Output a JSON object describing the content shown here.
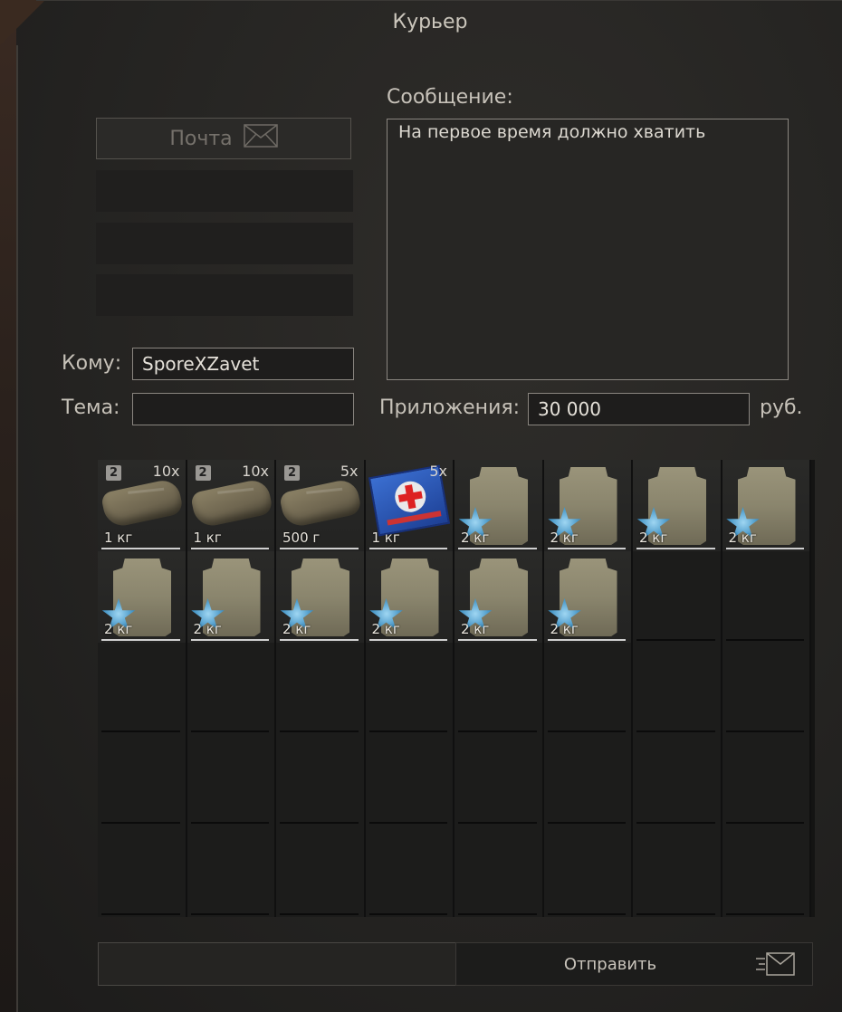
{
  "window": {
    "title": "Курьер"
  },
  "left_panel": {
    "mail_button": {
      "label": "Почта",
      "icon": "envelope-icon"
    },
    "empty_slots": 3
  },
  "form": {
    "to_label": "Кому:",
    "to_value": "SporeXZavet",
    "subject_label": "Тема:",
    "subject_value": "",
    "message_label": "Сообщение:",
    "message_text": "На первое время должно хватить",
    "attachments_label": "Приложения:",
    "attachments_value": "30 000",
    "currency": "руб."
  },
  "inventory": {
    "columns": 8,
    "rows": 5,
    "items": [
      {
        "kind": "bandage",
        "level": "2",
        "count": "10x",
        "weight": "1 кг"
      },
      {
        "kind": "bandage",
        "level": "2",
        "count": "10x",
        "weight": "1 кг"
      },
      {
        "kind": "bandage",
        "level": "2",
        "count": "5x",
        "weight": "500 г"
      },
      {
        "kind": "medkit",
        "level": "",
        "count": "5x",
        "weight": "1 кг"
      },
      {
        "kind": "armor-plate",
        "level": "",
        "count": "",
        "weight": "2 кг"
      },
      {
        "kind": "armor-plate",
        "level": "",
        "count": "",
        "weight": "2 кг"
      },
      {
        "kind": "armor-plate",
        "level": "",
        "count": "",
        "weight": "2 кг"
      },
      {
        "kind": "armor-plate",
        "level": "",
        "count": "",
        "weight": "2 кг"
      },
      {
        "kind": "armor-plate",
        "level": "",
        "count": "",
        "weight": "2 кг"
      },
      {
        "kind": "armor-plate",
        "level": "",
        "count": "",
        "weight": "2 кг"
      },
      {
        "kind": "armor-plate",
        "level": "",
        "count": "",
        "weight": "2 кг"
      },
      {
        "kind": "armor-plate",
        "level": "",
        "count": "",
        "weight": "2 кг"
      },
      {
        "kind": "armor-plate",
        "level": "",
        "count": "",
        "weight": "2 кг"
      },
      {
        "kind": "armor-plate",
        "level": "",
        "count": "",
        "weight": "2 кг"
      }
    ]
  },
  "footer": {
    "send_label": "Отправить",
    "send_icon": "send-mail-icon"
  }
}
